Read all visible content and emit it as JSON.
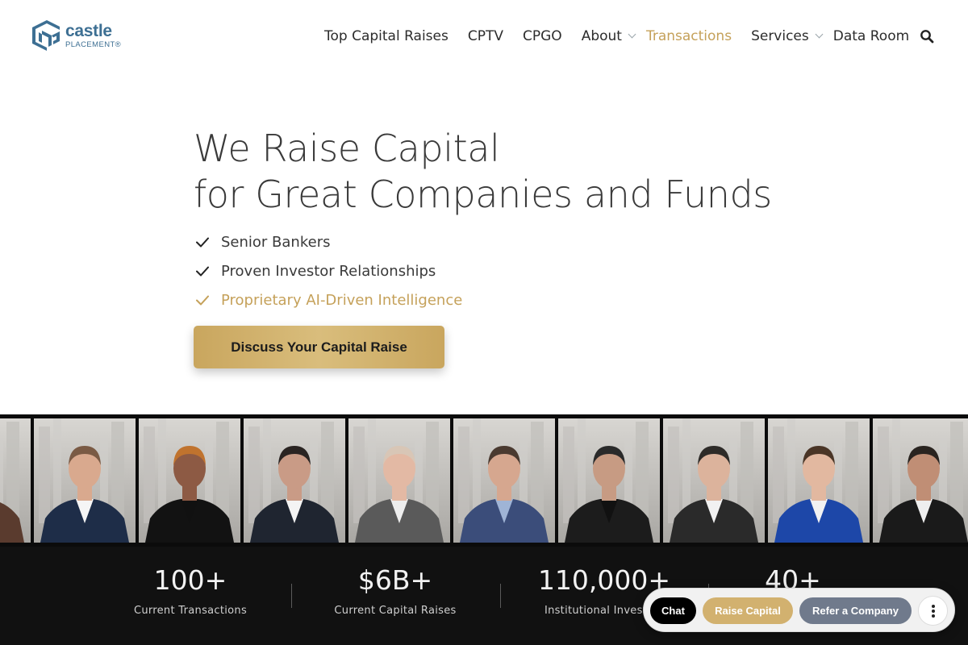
{
  "brand": {
    "name": "castle",
    "sub": "PLACEMENT®",
    "color": "#3d6f93",
    "logo_icon": "cp-cube-logo"
  },
  "nav": {
    "items": [
      {
        "label": "Top Capital Raises",
        "has_dropdown": false,
        "active": false
      },
      {
        "label": "CPTV",
        "has_dropdown": false,
        "active": false
      },
      {
        "label": "CPGO",
        "has_dropdown": false,
        "active": false
      },
      {
        "label": "About",
        "has_dropdown": true,
        "active": false
      },
      {
        "label": "Transactions",
        "has_dropdown": false,
        "active": true
      },
      {
        "label": "Services",
        "has_dropdown": true,
        "active": false
      },
      {
        "label": "Data Room",
        "has_dropdown": false,
        "active": false
      }
    ],
    "search_icon": "search-icon"
  },
  "hero": {
    "title_line1": "We Raise Capital",
    "title_line2": "for Great Companies and Funds",
    "checklist": [
      {
        "text": "Senior Bankers",
        "highlight": false
      },
      {
        "text": "Proven Investor Relationships",
        "highlight": false
      },
      {
        "text": "Proprietary AI-Driven Intelligence",
        "highlight": true
      }
    ],
    "cta_label": "Discuss Your Capital Raise",
    "accent_color": "#c5a15a"
  },
  "team_photos": {
    "count": 10,
    "description_icon": "team-member-portrait"
  },
  "stats": [
    {
      "value": "100+",
      "label": "Current Transactions"
    },
    {
      "value": "$6B+",
      "label": "Current Capital Raises"
    },
    {
      "value": "110,000+",
      "label": "Institutional Investors"
    },
    {
      "value": "40+",
      "label": ""
    }
  ],
  "action_bar": {
    "chat_label": "Chat",
    "raise_label": "Raise Capital",
    "refer_label": "Refer a Company",
    "more_icon": "more-vertical-icon"
  }
}
